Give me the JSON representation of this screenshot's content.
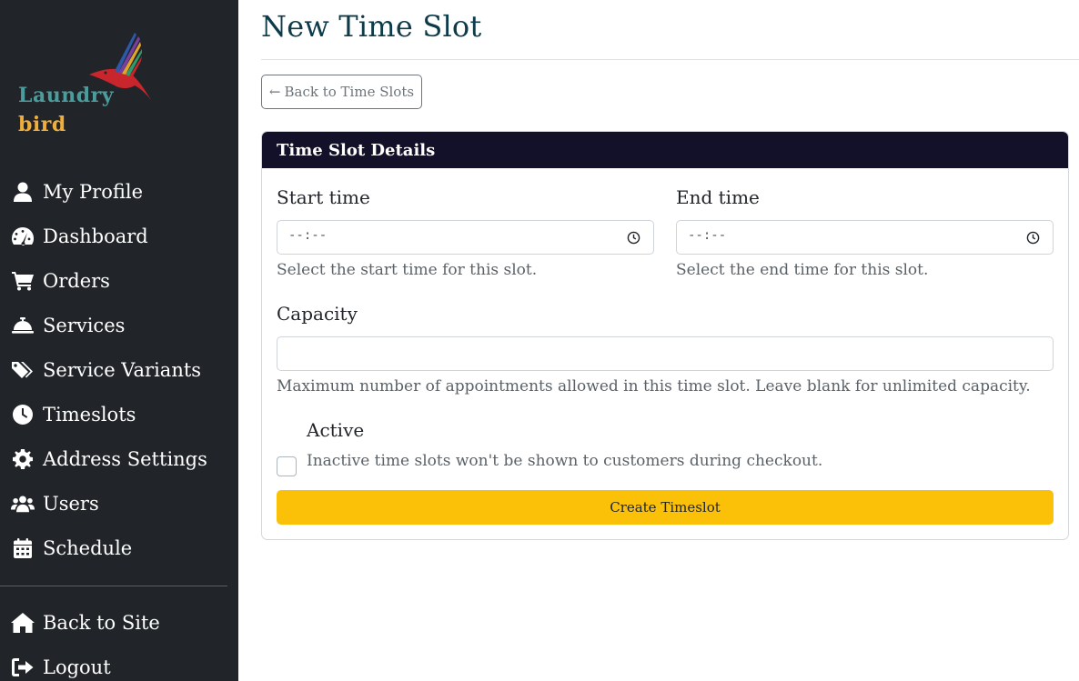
{
  "brand": {
    "line1": "Laundry",
    "line2": "bird"
  },
  "sidebar": {
    "items": [
      {
        "label": "My Profile",
        "icon": "user-icon"
      },
      {
        "label": "Dashboard",
        "icon": "gauge-icon"
      },
      {
        "label": "Orders",
        "icon": "cart-icon"
      },
      {
        "label": "Services",
        "icon": "bell-concierge-icon"
      },
      {
        "label": "Service Variants",
        "icon": "tags-icon"
      },
      {
        "label": "Timeslots",
        "icon": "clock-icon"
      },
      {
        "label": "Address Settings",
        "icon": "gear-icon"
      },
      {
        "label": "Users",
        "icon": "users-icon"
      },
      {
        "label": "Schedule",
        "icon": "calendar-icon"
      }
    ],
    "bottom_items": [
      {
        "label": "Back to Site",
        "icon": "home-icon"
      },
      {
        "label": "Logout",
        "icon": "logout-icon"
      }
    ]
  },
  "page": {
    "title": "New Time Slot",
    "back_label": "Back to Time Slots"
  },
  "card": {
    "header": "Time Slot Details",
    "start_time": {
      "label": "Start time",
      "value": "--:--",
      "help": "Select the start time for this slot."
    },
    "end_time": {
      "label": "End time",
      "value": "--:--",
      "help": "Select the end time for this slot."
    },
    "capacity": {
      "label": "Capacity",
      "value": "",
      "help": "Maximum number of appointments allowed in this time slot. Leave blank for unlimited capacity."
    },
    "active": {
      "label": "Active",
      "checked": false,
      "help": "Inactive time slots won't be shown to customers during checkout."
    },
    "submit_label": "Create Timeslot"
  },
  "colors": {
    "sidebar_bg": "#212529",
    "card_header_bg": "#13112a",
    "submit_bg": "#fbc108",
    "title_color": "#0d3b4a"
  }
}
